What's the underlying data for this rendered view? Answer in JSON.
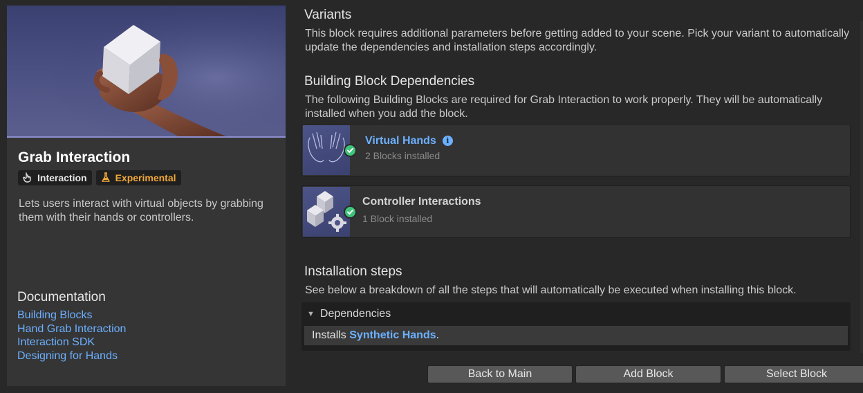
{
  "block": {
    "title": "Grab Interaction",
    "tags": [
      {
        "label": "Interaction",
        "icon": "hand-pointer-icon",
        "color": "#e6e6e6"
      },
      {
        "label": "Experimental",
        "icon": "flask-icon",
        "color": "#f0a83a"
      }
    ],
    "description": "Lets users interact with virtual objects by grabbing them with their hands or controllers."
  },
  "documentation": {
    "title": "Documentation",
    "links": [
      "Building Blocks",
      "Hand Grab Interaction",
      "Interaction SDK",
      "Designing for Hands"
    ]
  },
  "variants": {
    "title": "Variants",
    "body": "This block requires additional parameters before getting added to your scene. Pick your variant to automatically update the dependencies and installation steps accordingly."
  },
  "dependencies": {
    "title": "Building Block Dependencies",
    "body": "The following Building Blocks are required for Grab Interaction to work properly. They will be automatically installed when you add the block.",
    "items": [
      {
        "name": "Virtual Hands",
        "status": "2 Blocks installed",
        "name_color": "#6cb0ff",
        "installed": true
      },
      {
        "name": "Controller Interactions",
        "status": "1 Block installed",
        "name_color": "#d4d4d4",
        "installed": true
      }
    ]
  },
  "installation": {
    "title": "Installation steps",
    "body": "See below a breakdown of all the steps that will automatically be executed when installing this block.",
    "foldout_label": "Dependencies",
    "step_prefix": "Installs",
    "step_link": "Synthetic Hands",
    "step_suffix": "."
  },
  "buttons": {
    "back": "Back to Main",
    "add": "Add Block",
    "select": "Select Block"
  },
  "colors": {
    "accent_link": "#6cb0ff",
    "success": "#3ec47a",
    "experimental": "#f0a83a"
  }
}
